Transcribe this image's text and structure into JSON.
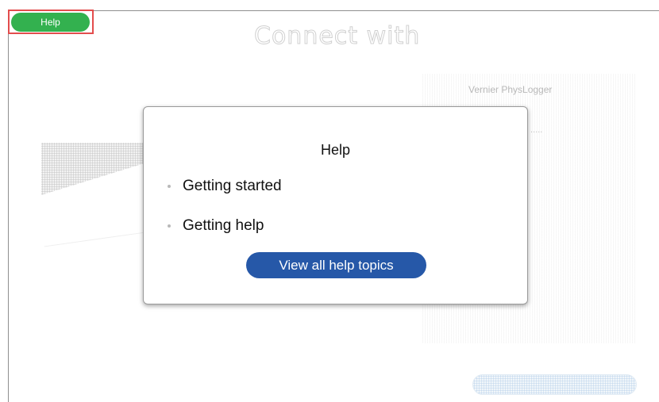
{
  "header": {
    "help_button_label": "Help",
    "background_title": "Connect with"
  },
  "background": {
    "right_card_label": "Vernier PhysLogger",
    "right_card_sub": "....."
  },
  "help_modal": {
    "title": "Help",
    "items": [
      {
        "label": "Getting started"
      },
      {
        "label": "Getting help"
      }
    ],
    "view_all_label": "View all help topics"
  },
  "colors": {
    "help_button": "#33b14f",
    "view_all_button": "#2658a8",
    "highlight_outline": "#e34d4d"
  }
}
